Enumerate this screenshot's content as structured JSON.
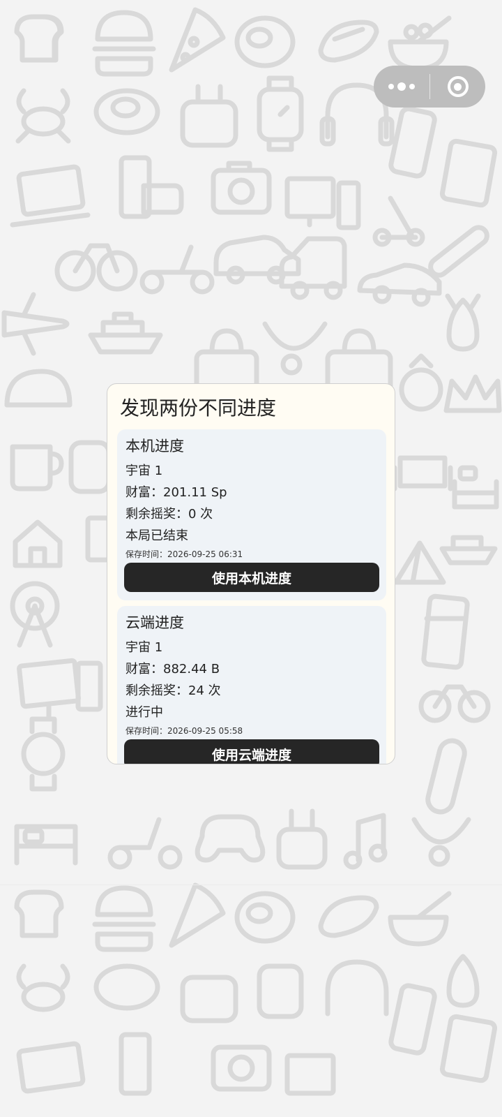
{
  "menu_capsule": {
    "more_icon": "more-dots-icon",
    "close_icon": "target-circle-icon"
  },
  "dialog": {
    "title": "发现两份不同进度",
    "local": {
      "title": "本机进度",
      "universe": "宇宙 1",
      "wealth": "财富：201.11 Sp",
      "remaining": "剩余摇奖：0 次",
      "status": "本局已结束",
      "saved_time": "保存时间：2026-09-25 06:31",
      "button": "使用本机进度"
    },
    "cloud": {
      "title": "云端进度",
      "universe": "宇宙 1",
      "wealth": "财富：882.44 B",
      "remaining": "剩余摇奖：24 次",
      "status": "进行中",
      "saved_time": "保存时间：2026-09-25 05:58",
      "button": "使用云端进度"
    }
  },
  "colors": {
    "background": "#f3f3f3",
    "pattern_stroke": "#d9d9d9",
    "dialog_bg": "#fffcf3",
    "card_bg": "#eff3f7",
    "button_bg": "#262626",
    "button_text": "#ffffff"
  }
}
